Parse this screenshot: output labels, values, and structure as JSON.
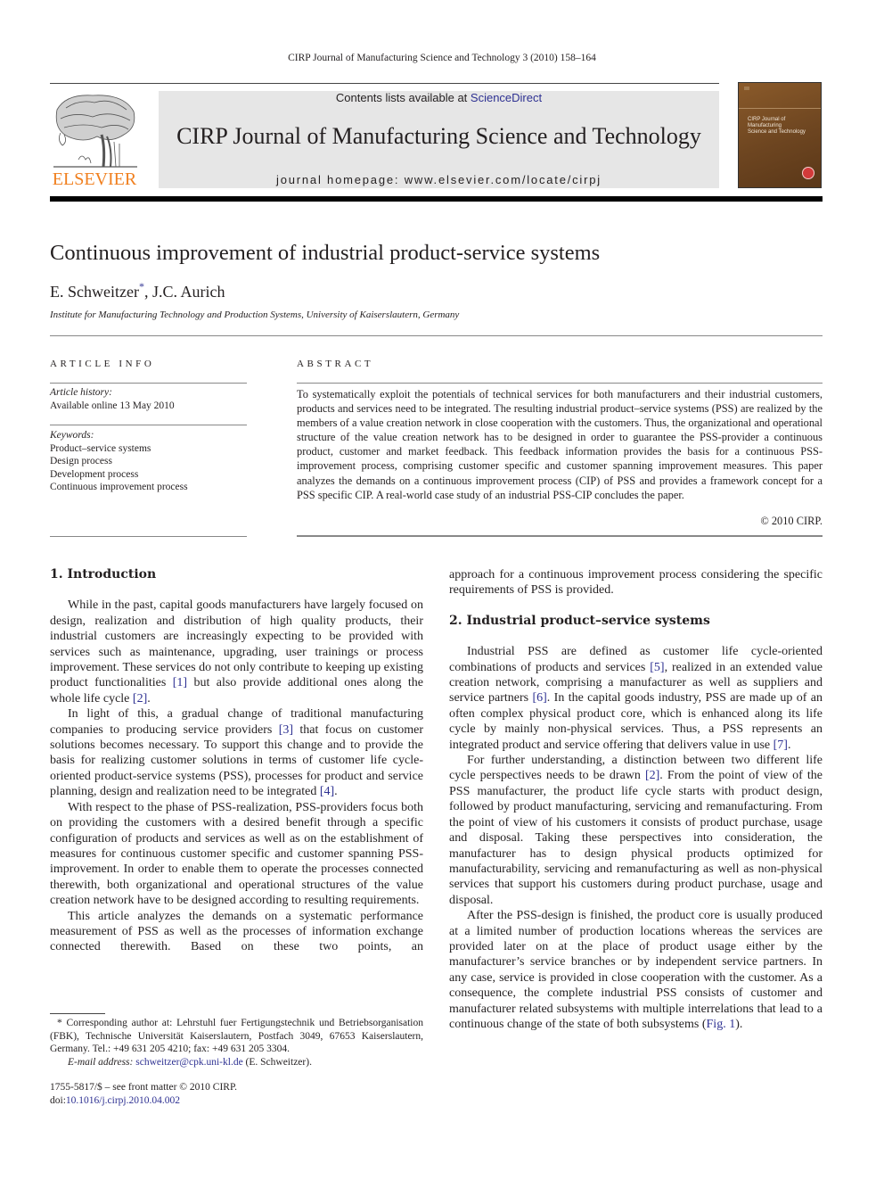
{
  "running_head": "CIRP Journal of Manufacturing Science and Technology 3 (2010) 158–164",
  "masthead": {
    "publisher_logo_text": "ELSEVIER",
    "contents_prefix": "Contents lists available at ",
    "contents_link": "ScienceDirect",
    "journal_title": "CIRP Journal of Manufacturing Science and Technology",
    "homepage": "journal homepage: www.elsevier.com/locate/cirpj",
    "cover_title": "CIRP Journal of\nManufacturing\nScience and Technology"
  },
  "article": {
    "title": "Continuous improvement of industrial product-service systems",
    "author1": "E. Schweitzer",
    "author1_mark": "*",
    "author_sep": ", ",
    "author2": "J.C. Aurich",
    "affiliation": "Institute for Manufacturing Technology and Production Systems, University of Kaiserslautern, Germany"
  },
  "article_info": {
    "heading": "ARTICLE INFO",
    "history_label": "Article history:",
    "history_value": "Available online 13 May 2010",
    "keywords_label": "Keywords:",
    "keywords": [
      "Product–service systems",
      "Design process",
      "Development process",
      "Continuous improvement process"
    ]
  },
  "abstract": {
    "heading": "ABSTRACT",
    "text": "To systematically exploit the potentials of technical services for both manufacturers and their industrial customers, products and services need to be integrated. The resulting industrial product–service systems (PSS) are realized by the members of a value creation network in close cooperation with the customers. Thus, the organizational and operational structure of the value creation network has to be designed in order to guarantee the PSS-provider a continuous product, customer and market feedback. This feedback information provides the basis for a continuous PSS-improvement process, comprising customer specific and customer spanning improvement measures. This paper analyzes the demands on a continuous improvement process (CIP) of PSS and provides a framework concept for a PSS specific CIP. A real-world case study of an industrial PSS-CIP concludes the paper.",
    "copyright": "© 2010 CIRP."
  },
  "body": {
    "sec1_heading": "1.  Introduction",
    "sec1_p1_a": "While in the past, capital goods manufacturers have largely focused on design, realization and distribution of high quality products, their industrial customers are increasingly expecting to be provided with services such as maintenance, upgrading, user trainings or process improvement. These services do not only contribute to keeping up existing product functionalities ",
    "ref1": "[1]",
    "sec1_p1_b": " but also provide additional ones along the whole life cycle ",
    "ref2": "[2]",
    "sec1_p1_c": ".",
    "sec1_p2_a": "In light of this, a gradual change of traditional manufacturing companies to producing service providers ",
    "ref3": "[3]",
    "sec1_p2_b": " that focus on customer solutions becomes necessary. To support this change and to provide the basis for realizing customer solutions in terms of customer life cycle-oriented product-service systems (PSS), processes for product and service planning, design and realization need to be integrated ",
    "ref4": "[4]",
    "sec1_p2_c": ".",
    "sec1_p3": "With respect to the phase of PSS-realization, PSS-providers focus both on providing the customers with a desired benefit through a specific configuration of products and services as well as on the establishment of measures for continuous customer specific and customer spanning PSS-improvement. In order to enable them to operate the processes connected therewith, both organizational and operational structures of the value creation network have to be designed according to resulting requirements.",
    "sec1_p4": "This article analyzes the demands on a systematic performance measurement of PSS as well as the processes of information exchange connected therewith. Based on these two points, an",
    "sec1_p4_cont": "approach for a continuous improvement process considering the specific requirements of PSS is provided.",
    "sec2_heading": "2.  Industrial product–service systems",
    "sec2_p1_a": "Industrial PSS are defined as customer life cycle-oriented combinations of products and services ",
    "ref5": "[5]",
    "sec2_p1_b": ", realized in an extended value creation network, comprising a manufacturer as well as suppliers and service partners ",
    "ref6": "[6]",
    "sec2_p1_c": ". In the capital goods industry, PSS are made up of an often complex physical product core, which is enhanced along its life cycle by mainly non-physical services. Thus, a PSS represents an integrated product and service offering that delivers value in use ",
    "ref7": "[7]",
    "sec2_p1_d": ".",
    "sec2_p2_a": "For further understanding, a distinction between two different life cycle perspectives needs to be drawn ",
    "ref2b": "[2]",
    "sec2_p2_b": ". From the point of view of the PSS manufacturer, the product life cycle starts with product design, followed by product manufacturing, servicing and remanufacturing. From the point of view of his customers it consists of product purchase, usage and disposal. Taking these perspectives into consideration, the manufacturer has to design physical products optimized for manufacturability, servicing and remanufacturing as well as non-physical services that support his customers during product purchase, usage and disposal.",
    "sec2_p3_a": "After the PSS-design is finished, the product core is usually produced at a limited number of production locations whereas the services are provided later on at the place of product usage either by the manufacturer’s service branches or by independent service partners. In any case, service is provided in close cooperation with the customer. As a consequence, the complete industrial PSS consists of customer and manufacturer related subsystems with multiple interrelations that lead to a continuous change of the state of both subsystems (",
    "fig1": "Fig. 1",
    "sec2_p3_b": ")."
  },
  "footnote": {
    "mark": "*",
    "text": " Corresponding author at: Lehrstuhl fuer Fertigungstechnik und Betriebsorganisation (FBK), Technische Universität Kaiserslautern, Postfach 3049, 67653 Kaiserslautern, Germany. Tel.: +49 631 205 4210; fax: +49 631 205 3304.",
    "email_label": "E-mail address: ",
    "email": "schweitzer@cpk.uni-kl.de",
    "email_suffix": " (E. Schweitzer)."
  },
  "front_matter": {
    "issn_line": "1755-5817/$ – see front matter © 2010 CIRP.",
    "doi_prefix": "doi:",
    "doi": "10.1016/j.cirpj.2010.04.002"
  }
}
